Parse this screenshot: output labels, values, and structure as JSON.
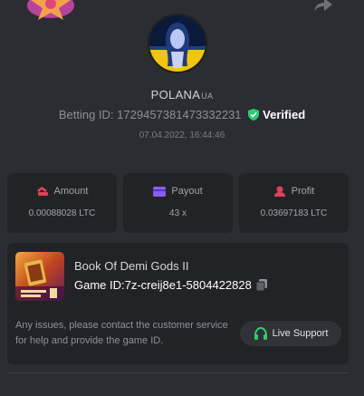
{
  "user": {
    "name": "POLANA",
    "name_suffix": "UA",
    "betting_id_label": "Betting ID:",
    "betting_id": "1729457381473332231",
    "verified_label": "Verified",
    "timestamp": "07.04.2022, 16:44:46"
  },
  "stats": [
    {
      "label": "Amount",
      "value": "0.00088028 LTC",
      "icon": "coins-icon"
    },
    {
      "label": "Payout",
      "value": "43 x",
      "icon": "card-icon"
    },
    {
      "label": "Profit",
      "value": "0.03697183 LTC",
      "icon": "profit-icon"
    }
  ],
  "game": {
    "title": "Book Of Demi Gods II",
    "id_label": "Game ID:",
    "id": "7z-creij8e1-5804422828",
    "help_text": "Any issues, please contact the customer service for help and provide the game ID.",
    "support_label": "Live Support"
  },
  "colors": {
    "background": "#2b2d32",
    "card": "#222327",
    "verified": "#2ecc71",
    "accent_red": "#e2405a",
    "accent_purple": "#8b5cf6"
  }
}
